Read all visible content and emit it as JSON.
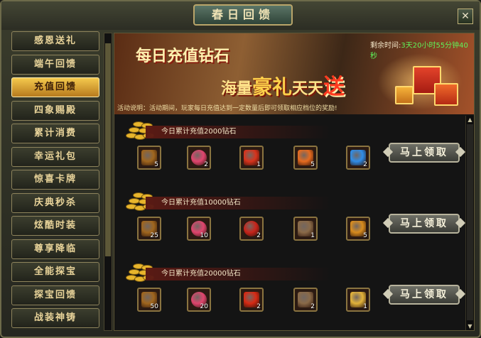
{
  "window": {
    "title": "春日回馈",
    "close_glyph": "✕"
  },
  "sidebar": {
    "items": [
      {
        "label": "感恩送礼",
        "active": false
      },
      {
        "label": "端午回馈",
        "active": false
      },
      {
        "label": "充值回馈",
        "active": true
      },
      {
        "label": "四象赐殿",
        "active": false
      },
      {
        "label": "累计消费",
        "active": false
      },
      {
        "label": "幸运礼包",
        "active": false
      },
      {
        "label": "惊喜卡牌",
        "active": false
      },
      {
        "label": "庆典秒杀",
        "active": false
      },
      {
        "label": "炫酷时装",
        "active": false
      },
      {
        "label": "尊享降临",
        "active": false
      },
      {
        "label": "全能探宝",
        "active": false
      },
      {
        "label": "探宝回馈",
        "active": false
      },
      {
        "label": "战装神铸",
        "active": false
      }
    ]
  },
  "banner": {
    "timer_label": "剩余时间:",
    "timer_value": "3天20小时55分钟40秒",
    "line1": "每日充值钻石",
    "line2_a": "海量",
    "line2_b": "豪礼",
    "line2_c": "天天",
    "line2_d": "送",
    "note": "活动说明：活动期间，玩家每日充值达到一定数量后即可领取相应档位的奖励!"
  },
  "rewards": [
    {
      "desc": "今日累计充值2000钻石",
      "claim_label": "马上领取",
      "items": [
        {
          "icon": "treasure-chest-icon",
          "qty": "5",
          "color": "#a0661e"
        },
        {
          "icon": "ruby-orb-icon",
          "qty": "2",
          "color": "#e0456e"
        },
        {
          "icon": "fire-gem-icon",
          "qty": "1",
          "color": "#d8331c"
        },
        {
          "icon": "phoenix-wing-icon",
          "qty": "5",
          "color": "#e66b1f"
        },
        {
          "icon": "blue-crystal-icon",
          "qty": "2",
          "color": "#2f8de8"
        }
      ]
    },
    {
      "desc": "今日累计充值10000钻石",
      "claim_label": "马上领取",
      "items": [
        {
          "icon": "treasure-chest-icon",
          "qty": "25",
          "color": "#a0661e"
        },
        {
          "icon": "ruby-orb-icon",
          "qty": "10",
          "color": "#e0456e"
        },
        {
          "icon": "red-ring-icon",
          "qty": "2",
          "color": "#c8241a"
        },
        {
          "icon": "jeweled-chest-icon",
          "qty": "1",
          "color": "#8a6a48"
        },
        {
          "icon": "gold-chalice-icon",
          "qty": "5",
          "color": "#d98c1e"
        }
      ]
    },
    {
      "desc": "今日累计充值20000钻石",
      "claim_label": "马上领取",
      "items": [
        {
          "icon": "treasure-chest-icon",
          "qty": "50",
          "color": "#a0661e"
        },
        {
          "icon": "ruby-orb-icon",
          "qty": "20",
          "color": "#e0456e"
        },
        {
          "icon": "red-triangle-icon",
          "qty": "2",
          "color": "#d82a14"
        },
        {
          "icon": "jeweled-chest-icon",
          "qty": "2",
          "color": "#8a6a48"
        },
        {
          "icon": "golden-box-icon",
          "qty": "1",
          "color": "#e3b33a"
        }
      ]
    }
  ]
}
